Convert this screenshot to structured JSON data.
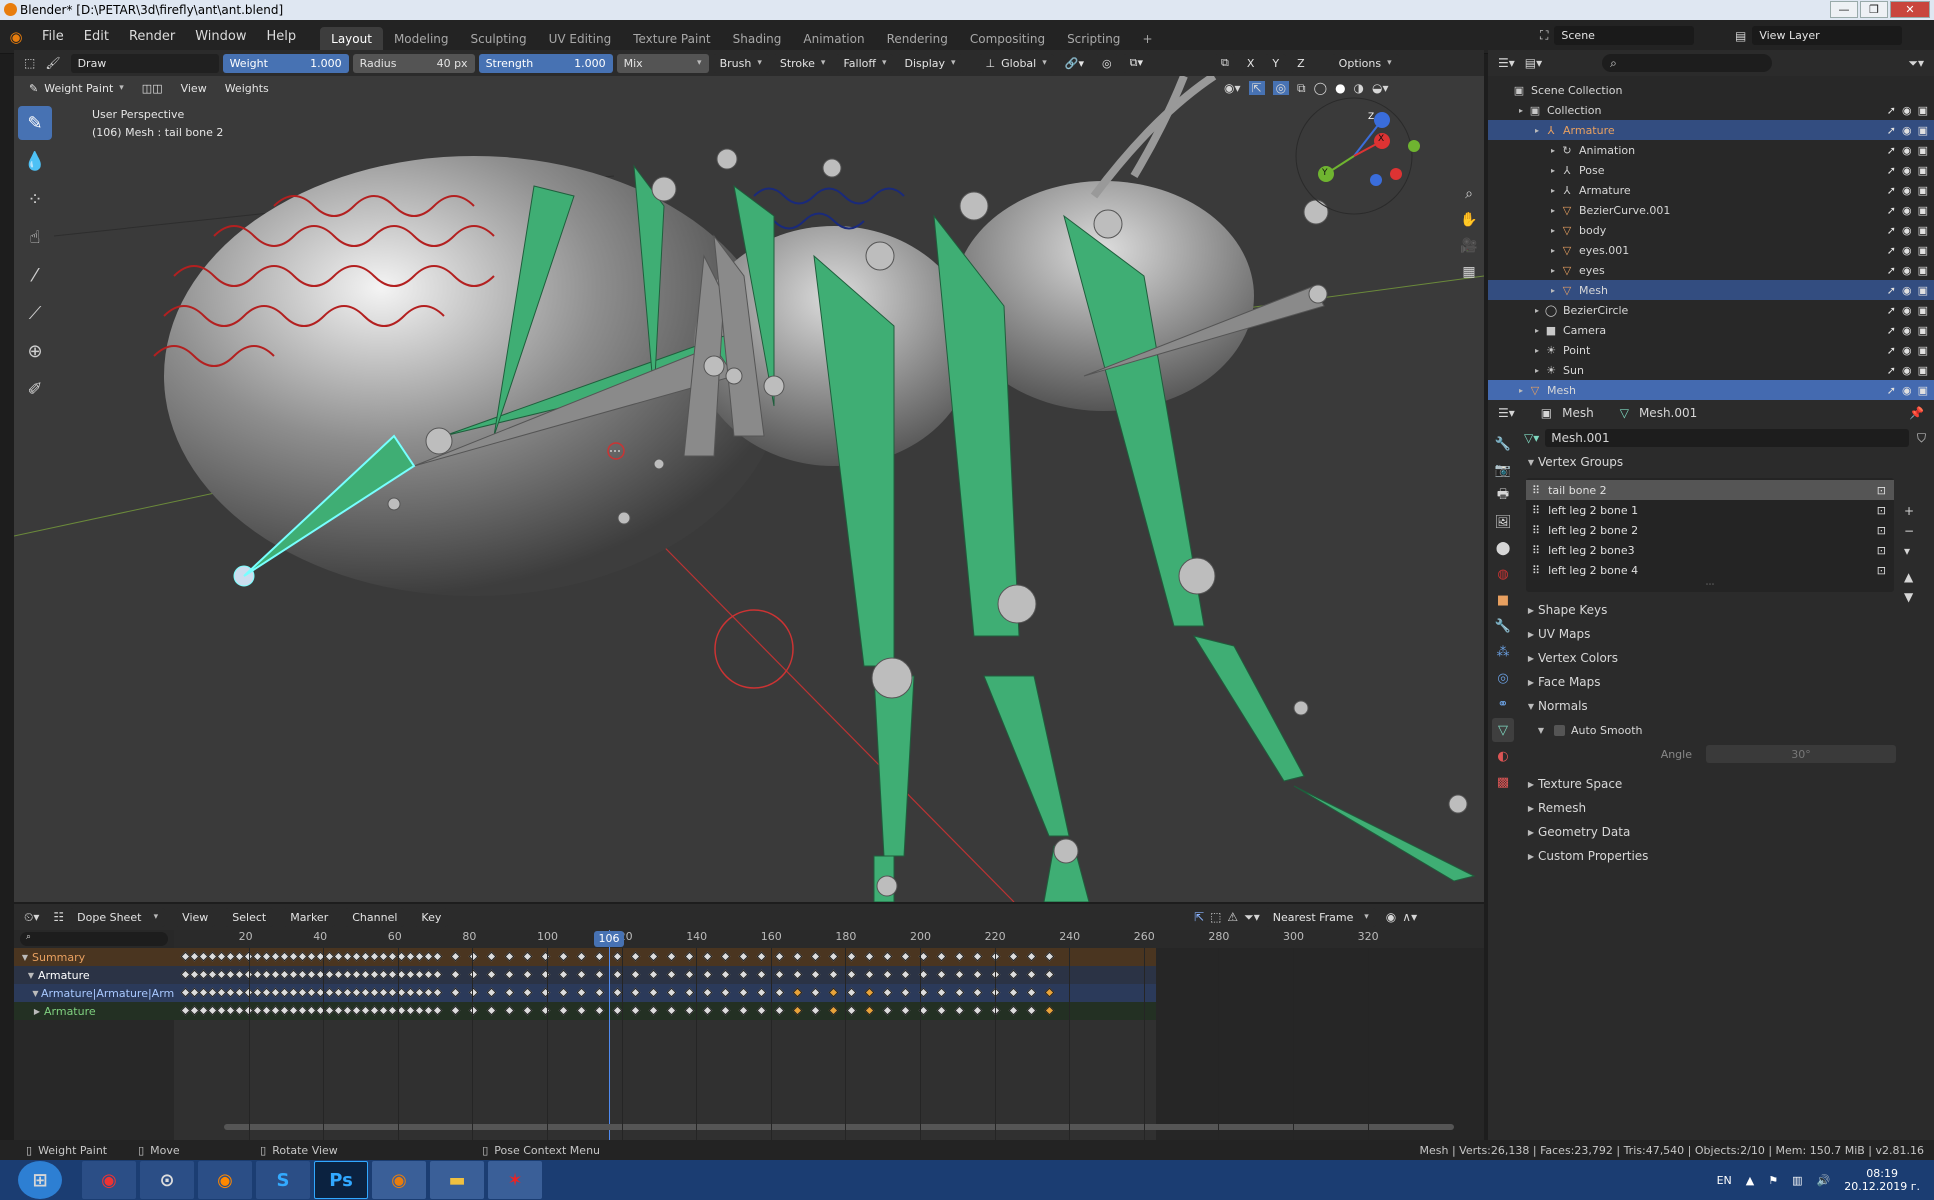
{
  "window": {
    "title": "Blender* [D:\\PETAR\\3d\\firefly\\ant\\ant.blend]",
    "minimize": "—",
    "maximize": "❐",
    "close": "✕"
  },
  "menubar": {
    "items": [
      "File",
      "Edit",
      "Render",
      "Window",
      "Help"
    ],
    "workspaces": [
      "Layout",
      "Modeling",
      "Sculpting",
      "UV Editing",
      "Texture Paint",
      "Shading",
      "Animation",
      "Rendering",
      "Compositing",
      "Scripting"
    ],
    "active_workspace": "Layout",
    "add_ws": "+",
    "scene": "Scene",
    "view_layer": "View Layer"
  },
  "tool_header": {
    "brush": "Draw",
    "weight_label": "Weight",
    "weight_value": "1.000",
    "radius_label": "Radius",
    "radius_value": "40 px",
    "strength_label": "Strength",
    "strength_value": "1.000",
    "blend": "Mix",
    "menus": [
      "Brush",
      "Stroke",
      "Falloff",
      "Display"
    ],
    "orientation": "Global",
    "axes": [
      "X",
      "Y",
      "Z"
    ],
    "options": "Options"
  },
  "viewport_header": {
    "mode": "Weight Paint",
    "menus": [
      "View",
      "Weights"
    ]
  },
  "viewport": {
    "perspective": "User Perspective",
    "object_info": "(106) Mesh : tail bone 2",
    "gizmo_axes": [
      "X",
      "Y",
      "Z"
    ]
  },
  "outliner": {
    "search_placeholder": "",
    "rows": [
      {
        "label": "Scene Collection",
        "icon": "scene-collection-icon",
        "glyph": "▣",
        "depth": 0
      },
      {
        "label": "Collection",
        "icon": "collection-icon",
        "glyph": "▣",
        "depth": 1
      },
      {
        "label": "Armature",
        "icon": "armature-icon",
        "glyph": "⅄",
        "depth": 2,
        "selected": true,
        "color": "#e8a060"
      },
      {
        "label": "Animation",
        "icon": "animation-icon",
        "glyph": "↻",
        "depth": 3
      },
      {
        "label": "Pose",
        "icon": "pose-icon",
        "glyph": "⅄",
        "depth": 3
      },
      {
        "label": "Armature",
        "icon": "armature-data-icon",
        "glyph": "⅄",
        "depth": 3
      },
      {
        "label": "BezierCurve.001",
        "icon": "mesh-icon",
        "glyph": "▽",
        "depth": 3
      },
      {
        "label": "body",
        "icon": "mesh-icon",
        "glyph": "▽",
        "depth": 3
      },
      {
        "label": "eyes.001",
        "icon": "mesh-icon",
        "glyph": "▽",
        "depth": 3
      },
      {
        "label": "eyes",
        "icon": "mesh-icon",
        "glyph": "▽",
        "depth": 3
      },
      {
        "label": "Mesh",
        "icon": "mesh-icon",
        "glyph": "▽",
        "depth": 3,
        "selected": true
      },
      {
        "label": "BezierCircle",
        "icon": "curve-icon",
        "glyph": "◯",
        "depth": 2
      },
      {
        "label": "Camera",
        "icon": "camera-icon",
        "glyph": "■",
        "depth": 2
      },
      {
        "label": "Point",
        "icon": "light-icon",
        "glyph": "☀",
        "depth": 2
      },
      {
        "label": "Sun",
        "icon": "sun-icon",
        "glyph": "☀",
        "depth": 2
      },
      {
        "label": "Mesh",
        "icon": "mesh-icon",
        "glyph": "▽",
        "depth": 1,
        "selected": true,
        "active": true
      }
    ]
  },
  "properties": {
    "object": "Mesh",
    "data": "Mesh.001",
    "data_field": "Mesh.001",
    "vertex_groups_label": "Vertex Groups",
    "vertex_groups": [
      "tail bone 2",
      "left leg 2 bone 1",
      "left leg 2 bone 2",
      "left leg 2 bone3",
      "left leg 2 bone 4"
    ],
    "panels_a": [
      "Shape Keys",
      "UV Maps",
      "Vertex Colors",
      "Face Maps"
    ],
    "normals": "Normals",
    "auto_smooth": "Auto Smooth",
    "angle_label": "Angle",
    "angle_value": "30°",
    "panels_b": [
      "Texture Space",
      "Remesh",
      "Geometry Data",
      "Custom Properties"
    ]
  },
  "dopesheet": {
    "editor": "Dope Sheet",
    "menus": [
      "View",
      "Select",
      "Marker",
      "Channel",
      "Key"
    ],
    "snap": "Nearest Frame",
    "frame_ticks": [
      "20",
      "40",
      "60",
      "80",
      "100",
      "120",
      "140",
      "160",
      "180",
      "200",
      "220",
      "240",
      "260",
      "280",
      "300",
      "320"
    ],
    "current_frame": "106",
    "channels": [
      {
        "label": "Summary",
        "color": "#e8a060",
        "bg": "#4a3520"
      },
      {
        "label": "Armature",
        "color": "#ffffff",
        "bg": "#2b3345"
      },
      {
        "label": "Armature|Armature|ArmatureA",
        "color": "#a8c8ff",
        "bg": "#2b3a5a"
      },
      {
        "label": "Armature",
        "color": "#7fd07f",
        "bg": "#233023"
      }
    ]
  },
  "statusbar": {
    "left": [
      "Weight Paint",
      "Move",
      "Rotate View",
      "Pose Context Menu"
    ],
    "stats": "Mesh | Verts:26,138 | Faces:23,792 | Tris:47,540 | Objects:2/10 | Mem: 150.7 MiB | v2.81.16"
  },
  "taskbar": {
    "lang": "EN",
    "time": "08:19",
    "date": "20.12.2019 г.",
    "apps": [
      "start",
      "chrome",
      "steam",
      "firefox",
      "skype",
      "photoshop",
      "blender",
      "explorer",
      "app"
    ]
  }
}
